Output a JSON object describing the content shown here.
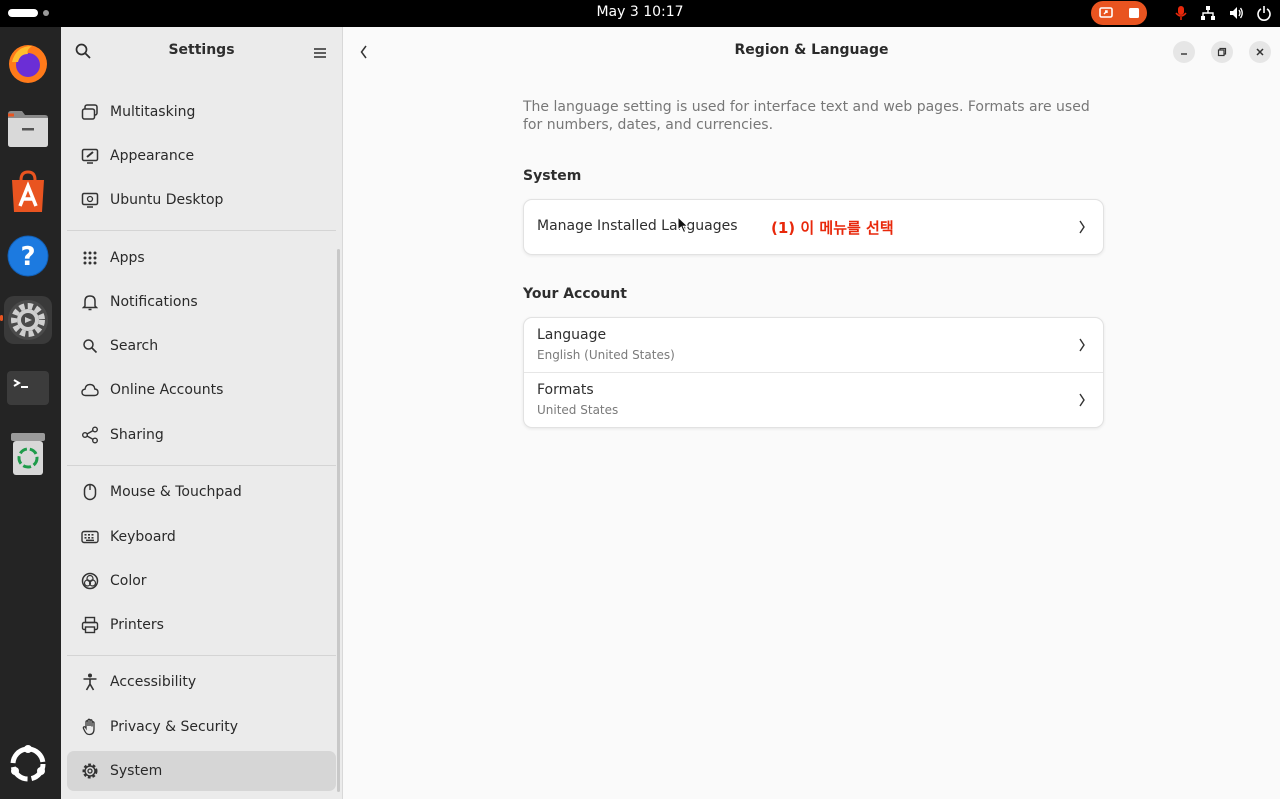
{
  "topbar": {
    "clock": "May 3  10:17"
  },
  "colors": {
    "accent": "#e95420",
    "annotation": "#e8280b"
  },
  "dock": {
    "items": [
      {
        "name": "firefox-icon"
      },
      {
        "name": "files-icon"
      },
      {
        "name": "app-center-icon"
      },
      {
        "name": "help-icon"
      },
      {
        "name": "settings-icon"
      },
      {
        "name": "terminal-icon"
      },
      {
        "name": "trash-icon"
      },
      {
        "name": "show-apps-icon"
      }
    ]
  },
  "sidebar": {
    "title": "Settings",
    "items": [
      {
        "label": "Multitasking",
        "icon": "multitasking-icon"
      },
      {
        "label": "Appearance",
        "icon": "appearance-icon"
      },
      {
        "label": "Ubuntu Desktop",
        "icon": "ubuntu-desktop-icon"
      },
      {
        "label": "Apps",
        "icon": "apps-grid-icon"
      },
      {
        "label": "Notifications",
        "icon": "bell-icon"
      },
      {
        "label": "Search",
        "icon": "search-icon"
      },
      {
        "label": "Online Accounts",
        "icon": "cloud-icon"
      },
      {
        "label": "Sharing",
        "icon": "share-icon"
      },
      {
        "label": "Mouse & Touchpad",
        "icon": "mouse-icon"
      },
      {
        "label": "Keyboard",
        "icon": "keyboard-icon"
      },
      {
        "label": "Color",
        "icon": "color-icon"
      },
      {
        "label": "Printers",
        "icon": "printer-icon"
      },
      {
        "label": "Accessibility",
        "icon": "accessibility-icon"
      },
      {
        "label": "Privacy & Security",
        "icon": "hand-icon"
      },
      {
        "label": "System",
        "icon": "gear-icon",
        "selected": true
      }
    ]
  },
  "main": {
    "title": "Region & Language",
    "description": "The language setting is used for interface text and web pages. Formats are used for numbers, dates, and currencies.",
    "system_section": {
      "heading": "System",
      "rows": [
        {
          "title": "Manage Installed Languages"
        }
      ]
    },
    "account_section": {
      "heading": "Your Account",
      "rows": [
        {
          "title": "Language",
          "subtitle": "English (United States)"
        },
        {
          "title": "Formats",
          "subtitle": "United States"
        }
      ]
    },
    "annotation": "(1) 이 메뉴를 선택"
  }
}
